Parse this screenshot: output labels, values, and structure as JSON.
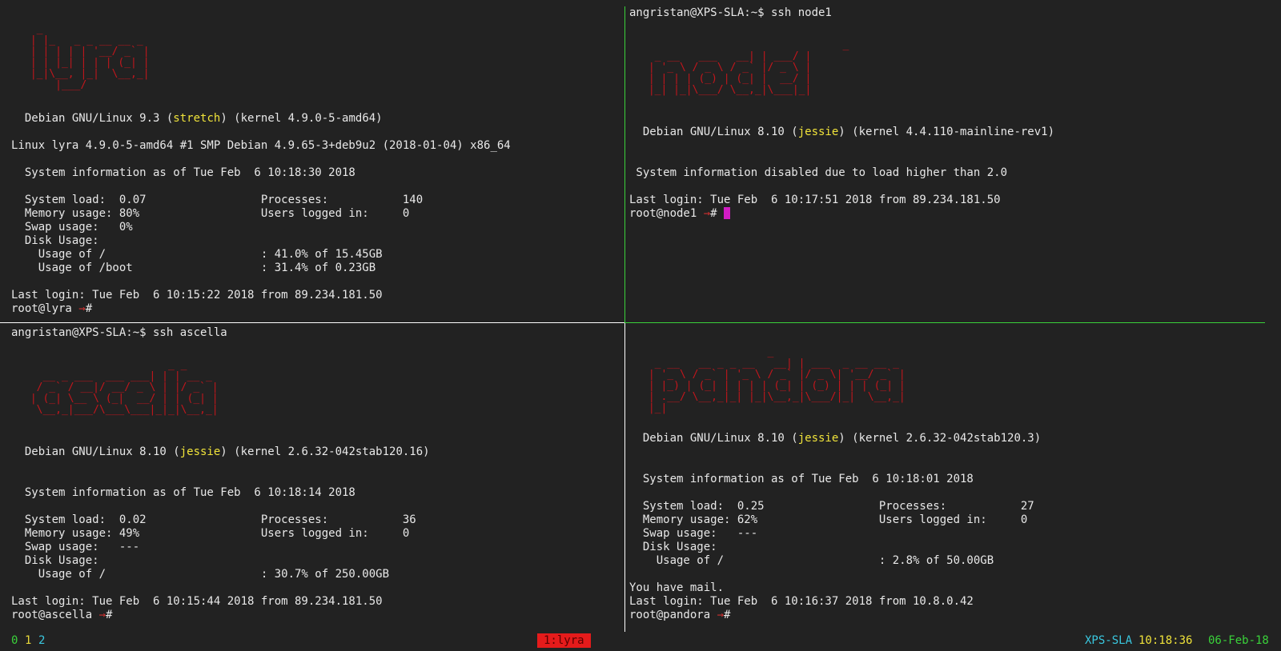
{
  "colors": {
    "background": "#222222",
    "foreground": "#e8e8e8",
    "ascii_art": "#c3161c",
    "highlight": "#f0e33a",
    "active_border": "#3ad23a",
    "inactive_border": "#ffffff",
    "cursor": "#d21cc4",
    "active_window_bg": "#e51b1b"
  },
  "panes": {
    "lyra": {
      "art": "  _\n | |_   _ _ __ __ _\n | | | | | '__/ _` |\n | | |_| | | | (_| |\n |_|\\__, |_|  \\__,_|\n     |___/",
      "distro_pre": "  Debian GNU/Linux 9.3 (",
      "codename": "stretch",
      "distro_post": ") (kernel 4.9.0-5-amd64)",
      "uname": "Linux lyra 4.9.0-5-amd64 #1 SMP Debian 4.9.65-3+deb9u2 (2018-01-04) x86_64",
      "sysinfo": "  System information as of Tue Feb  6 10:18:30 2018",
      "stats": [
        "  System load:  0.07                 Processes:           140",
        "  Memory usage: 80%                  Users logged in:     0",
        "  Swap usage:   0%",
        "  Disk Usage:",
        "    Usage of /                       : 41.0% of 15.45GB",
        "    Usage of /boot                   : 31.4% of 0.23GB"
      ],
      "last_login": "Last login: Tue Feb  6 10:15:22 2018 from 89.234.181.50",
      "prompt": "root@lyra ",
      "prompt_arrow": "→",
      "prompt_end": "#"
    },
    "node1": {
      "ssh_command": "angristan@XPS-SLA:~$ ssh node1",
      "art": "                                _\n  _ __   ___   __| | ___/ |\n | '_ \\ / _ \\ / _` |/ _ \\ |\n | | | | (_) | (_| |  __/ |\n |_| |_|\\___/ \\__,_|\\___|_|",
      "distro_pre": "  Debian GNU/Linux 8.10 (",
      "codename": "jessie",
      "distro_post": ") (kernel 4.4.110-mainline-rev1)",
      "sysinfo": " System information disabled due to load higher than 2.0",
      "last_login": "Last login: Tue Feb  6 10:17:51 2018 from 89.234.181.50",
      "prompt": "root@node1 ",
      "prompt_arrow": "→",
      "prompt_end": "# "
    },
    "ascella": {
      "ssh_command": "angristan@XPS-SLA:~$ ssh ascella",
      "art": "                       _ _\n   __ _ ___  ___ ___| | | __ _\n  / _` / __|/ __/ _ \\ | |/ _` |\n | (_| \\__ \\ (_|  __/ | | (_| |\n  \\__,_|___/\\___\\___|_|_|\\__,_|",
      "distro_pre": "  Debian GNU/Linux 8.10 (",
      "codename": "jessie",
      "distro_post": ") (kernel 2.6.32-042stab120.16)",
      "sysinfo": "  System information as of Tue Feb  6 10:18:14 2018",
      "stats": [
        "  System load:  0.02                 Processes:           36",
        "  Memory usage: 49%                  Users logged in:     0",
        "  Swap usage:   ---",
        "  Disk Usage:",
        "    Usage of /                       : 30.7% of 250.00GB"
      ],
      "last_login": "Last login: Tue Feb  6 10:15:44 2018 from 89.234.181.50",
      "prompt": "root@ascella ",
      "prompt_arrow": "→",
      "prompt_end": "#"
    },
    "pandora": {
      "art": "                    _\n  _ __   __ _ _ __   __| | ___  _ __ __ _\n | '_ \\ / _` | '_ \\ / _` |/ _ \\| '__/ _` |\n | |_) | (_| | | | | (_| | (_) | | | (_| |\n | .__/ \\__,_|_| |_|\\__,_|\\___/|_|  \\__,_|\n |_|",
      "distro_pre": "  Debian GNU/Linux 8.10 (",
      "codename": "jessie",
      "distro_post": ") (kernel 2.6.32-042stab120.3)",
      "sysinfo": "  System information as of Tue Feb  6 10:18:01 2018",
      "stats": [
        "  System load:  0.25                 Processes:           27",
        "  Memory usage: 62%                  Users logged in:     0",
        "  Swap usage:   ---",
        "  Disk Usage:",
        "    Usage of /                       : 2.8% of 50.00GB"
      ],
      "mail": "You have mail.",
      "last_login": "Last login: Tue Feb  6 10:16:37 2018 from 10.8.0.42",
      "prompt": "root@pandora ",
      "prompt_arrow": "→",
      "prompt_end": "#"
    }
  },
  "status_bar": {
    "windows": [
      "0",
      "1",
      "2"
    ],
    "active_window": "1:lyra",
    "hostname": "XPS-SLA",
    "time": "10:18:36",
    "date": "06-Feb-18"
  }
}
